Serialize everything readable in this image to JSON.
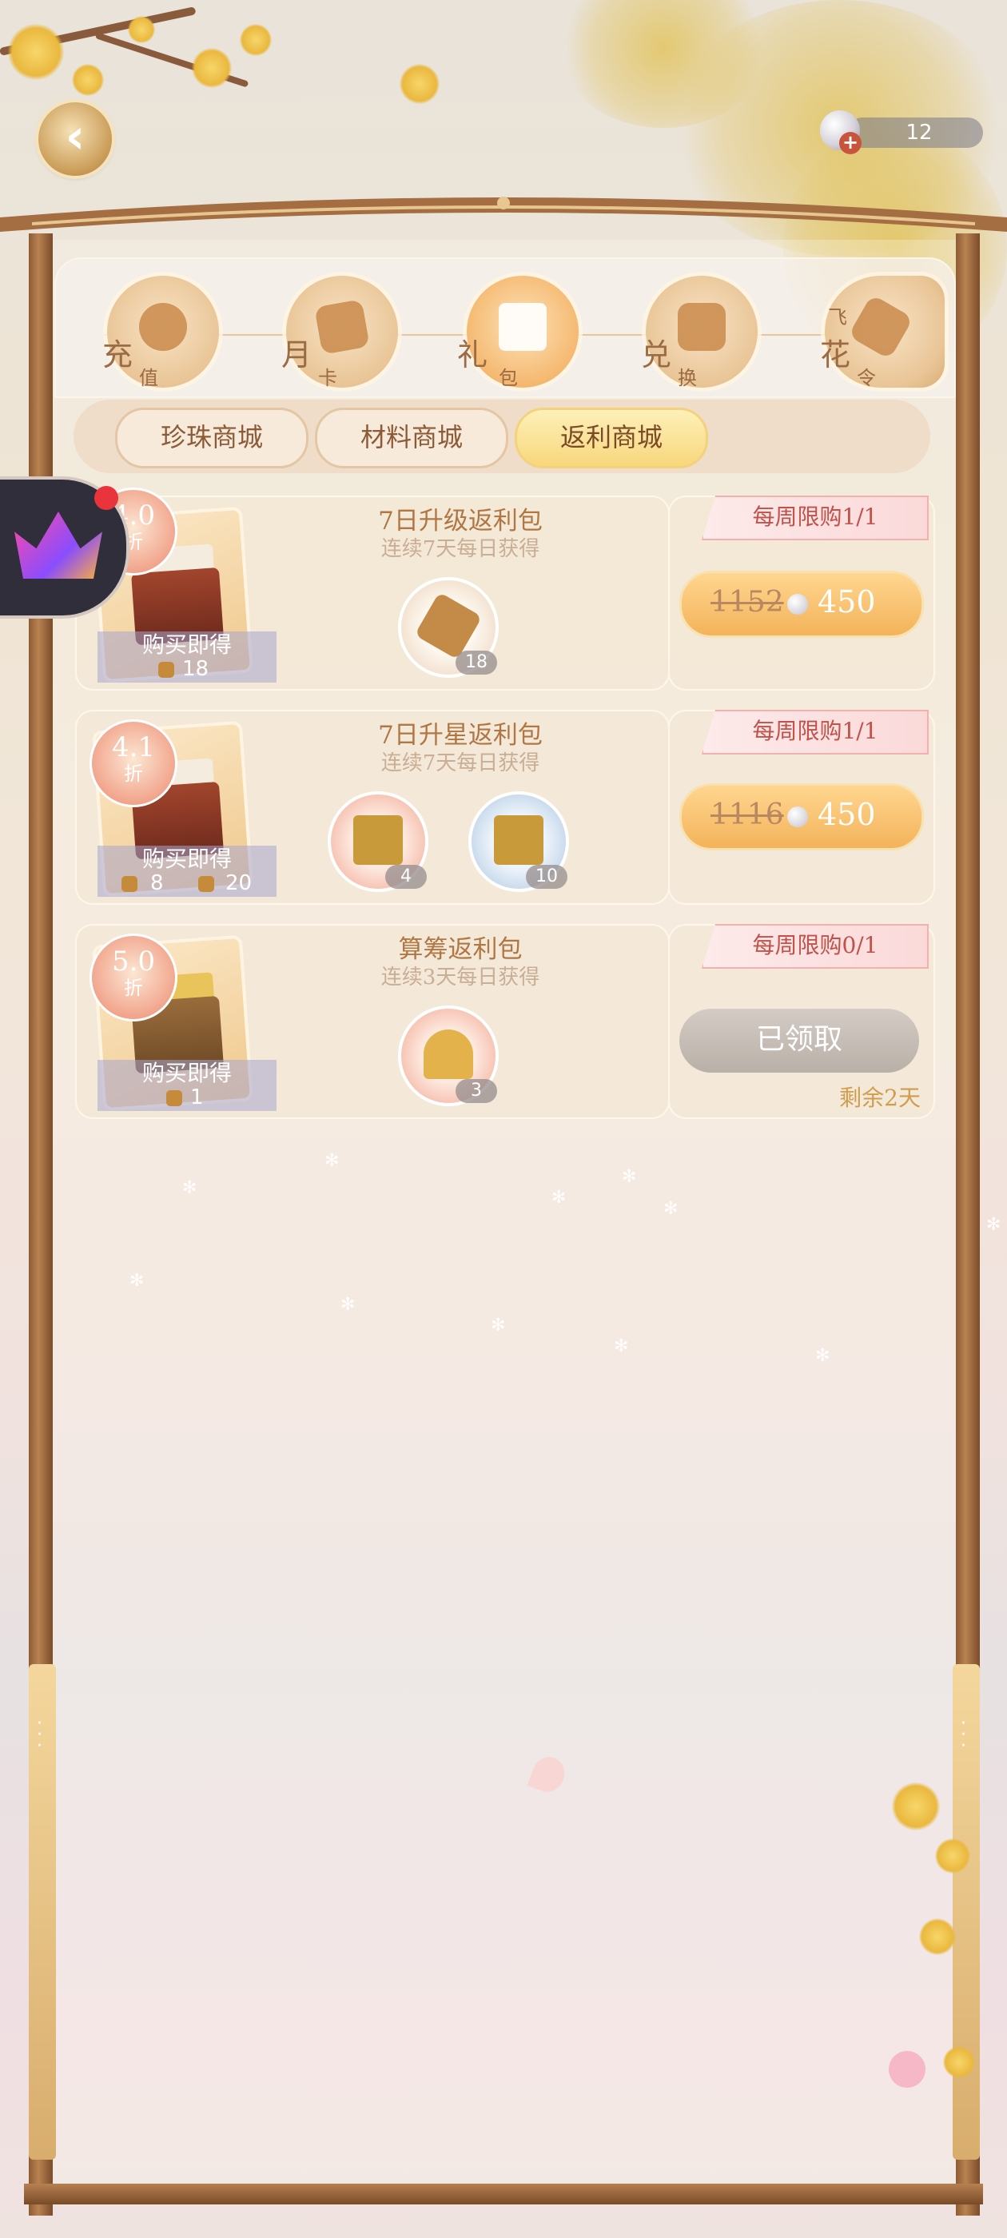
{
  "header": {
    "back_icon": "chevron-left-icon",
    "pearl_count": "12"
  },
  "categories": [
    {
      "label1": "充",
      "label2": "值",
      "icon": "coin-icon",
      "active": false
    },
    {
      "label1": "月",
      "label2": "卡",
      "icon": "cards-icon",
      "active": false
    },
    {
      "label1": "礼",
      "label2": "包",
      "icon": "gift-box-icon",
      "active": true
    },
    {
      "label1": "兑",
      "label2": "换",
      "icon": "present-icon",
      "active": false
    },
    {
      "label1": "花",
      "label2": "令",
      "label0": "飞",
      "icon": "scroll-icon",
      "active": false
    }
  ],
  "sub_tabs": [
    {
      "label": "珍珠商城",
      "active": false
    },
    {
      "label": "材料商城",
      "active": false
    },
    {
      "label": "返利商城",
      "active": true
    }
  ],
  "products": [
    {
      "discount": "4.0",
      "discount_unit": "折",
      "title": "7日升级返利包",
      "subtitle": "连续7天每日获得",
      "caption": "购买即得",
      "caption_items": [
        "18"
      ],
      "items": [
        {
          "icon": "scroll-bundle-icon",
          "count": "18"
        }
      ],
      "limit": "每周限购1/1",
      "old_price": "1152",
      "price": "450"
    },
    {
      "discount": "4.1",
      "discount_unit": "折",
      "title": "7日升星返利包",
      "subtitle": "连续7天每日获得",
      "caption": "购买即得",
      "caption_items": [
        "8",
        "20"
      ],
      "items": [
        {
          "icon": "gold-basket-icon",
          "count": "4"
        },
        {
          "icon": "gold-basket-icon",
          "count": "10"
        }
      ],
      "limit": "每周限购1/1",
      "old_price": "1116",
      "price": "450"
    },
    {
      "discount": "5.0",
      "discount_unit": "折",
      "title": "算筹返利包",
      "subtitle": "连续3天每日获得",
      "caption": "购买即得",
      "caption_items": [
        "1"
      ],
      "items": [
        {
          "icon": "counting-rods-icon",
          "count": "3"
        }
      ],
      "limit": "每周限购0/1",
      "claimed_label": "已领取",
      "remaining": "剩余2天"
    }
  ],
  "colors": {
    "accent_gold": "#f3b35a",
    "frame_brown": "#8e5b34",
    "limit_red": "#c0524b",
    "claimed_gray": "#b9b0a8"
  }
}
